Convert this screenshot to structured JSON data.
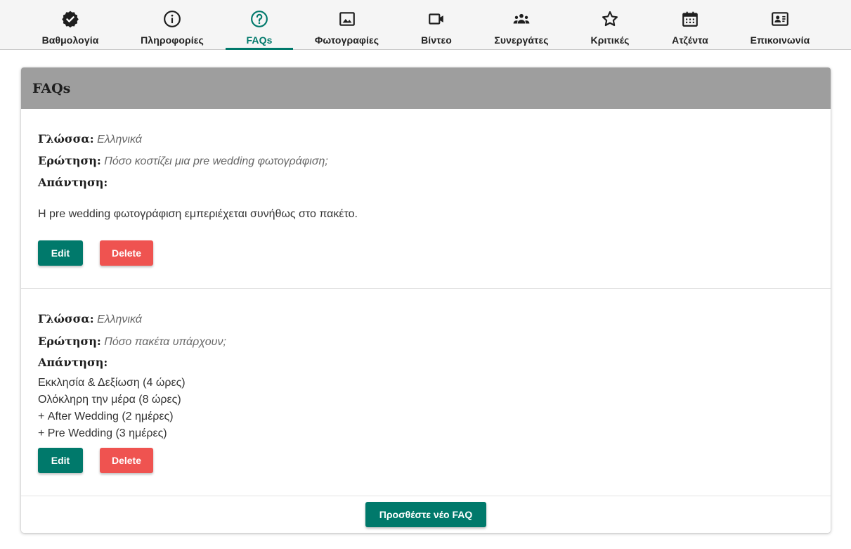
{
  "tabs": [
    {
      "label": "Βαθμολογία",
      "icon": "verified-badge-icon"
    },
    {
      "label": "Πληροφορίες",
      "icon": "info-icon"
    },
    {
      "label": "FAQs",
      "icon": "help-circle-icon",
      "active": true
    },
    {
      "label": "Φωτογραφίες",
      "icon": "image-icon"
    },
    {
      "label": "Βίντεο",
      "icon": "video-camera-icon"
    },
    {
      "label": "Συνεργάτες",
      "icon": "group-icon"
    },
    {
      "label": "Κριτικές",
      "icon": "star-icon"
    },
    {
      "label": "Ατζέντα",
      "icon": "calendar-icon"
    },
    {
      "label": "Επικοινωνία",
      "icon": "contact-card-icon"
    }
  ],
  "section": {
    "title": "FAQs"
  },
  "labels": {
    "language": "Γλώσσα:",
    "question": "Ερώτηση:",
    "answer": "Απάντηση:"
  },
  "faqs": [
    {
      "language": "Ελληνικά",
      "question": "Πόσο κοστίζει μια pre wedding φωτογράφιση;",
      "answer": "Η pre wedding φωτογράφιση εμπεριέχεται συνήθως στο πακέτο."
    },
    {
      "language": "Ελληνικά",
      "question": "Πόσο πακέτα υπάρχουν;",
      "answer": "Εκκλησία & Δεξίωση (4 ώρες)\nΟλόκληρη την μέρα (8 ώρες)\n+ After Wedding (2 ημέρες)\n+ Pre Wedding (3 ημέρες)"
    }
  ],
  "buttons": {
    "edit": "Edit",
    "delete": "Delete",
    "add": "Προσθέστε νέο FAQ"
  },
  "colors": {
    "accent": "#00796b",
    "danger": "#ef5350",
    "header": "#9e9e9e"
  }
}
